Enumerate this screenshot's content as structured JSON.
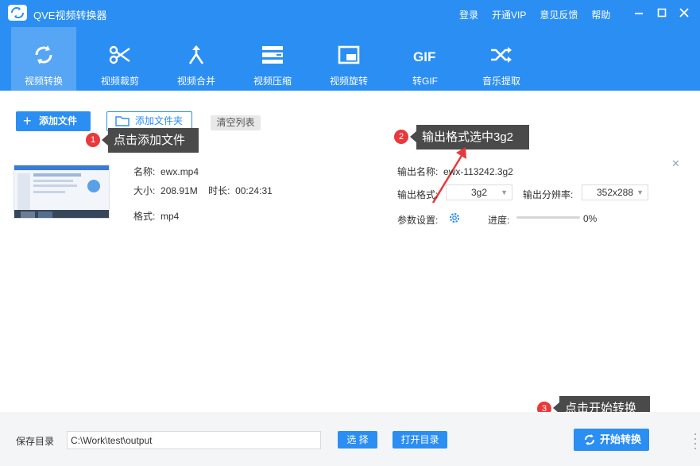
{
  "app": {
    "title": "QVE视频转换器"
  },
  "header_links": [
    {
      "label": "登录"
    },
    {
      "label": "开通VIP"
    },
    {
      "label": "意见反馈"
    },
    {
      "label": "帮助"
    }
  ],
  "toolbar": {
    "items": [
      {
        "label": "视频转换",
        "icon": "convert-icon",
        "active": true
      },
      {
        "label": "视频裁剪",
        "icon": "scissors-icon"
      },
      {
        "label": "视频合并",
        "icon": "merge-icon"
      },
      {
        "label": "视频压缩",
        "icon": "compress-icon"
      },
      {
        "label": "视频旋转",
        "icon": "rotate-icon"
      },
      {
        "label": "转GIF",
        "icon": "gif-icon"
      },
      {
        "label": "音乐提取",
        "icon": "shuffle-icon"
      }
    ]
  },
  "actions": {
    "add_file": "添加文件",
    "add_folder": "添加文件夹",
    "clear_list": "清空列表"
  },
  "tips": [
    {
      "num": "1",
      "text": "点击添加文件"
    },
    {
      "num": "2",
      "text": "输出格式选中3g2"
    },
    {
      "num": "3",
      "text": "点击开始转换"
    }
  ],
  "file": {
    "name_label": "名称:",
    "name": "ewx.mp4",
    "size_label": "大小:",
    "size": "208.91M",
    "duration_label": "时长:",
    "duration": "00:24:31",
    "format_label": "格式:",
    "format": "mp4"
  },
  "output": {
    "name_label": "输出名称:",
    "name": "ewx-113242.3g2",
    "format_label": "输出格式:",
    "format": "3g2",
    "resolution_label": "输出分辨率:",
    "resolution": "352x288",
    "params_label": "参数设置:",
    "progress_label": "进度:",
    "progress": 0,
    "progress_text": "0%"
  },
  "footer": {
    "save_dir_label": "保存目录",
    "save_dir": "C:\\Work\\test\\output",
    "choose": "选 择",
    "open_dir": "打开目录",
    "start": "开始转换"
  },
  "colors": {
    "brand": "#2b8ef3",
    "tip_bg": "#4a4a4a",
    "badge": "#e8393b"
  }
}
